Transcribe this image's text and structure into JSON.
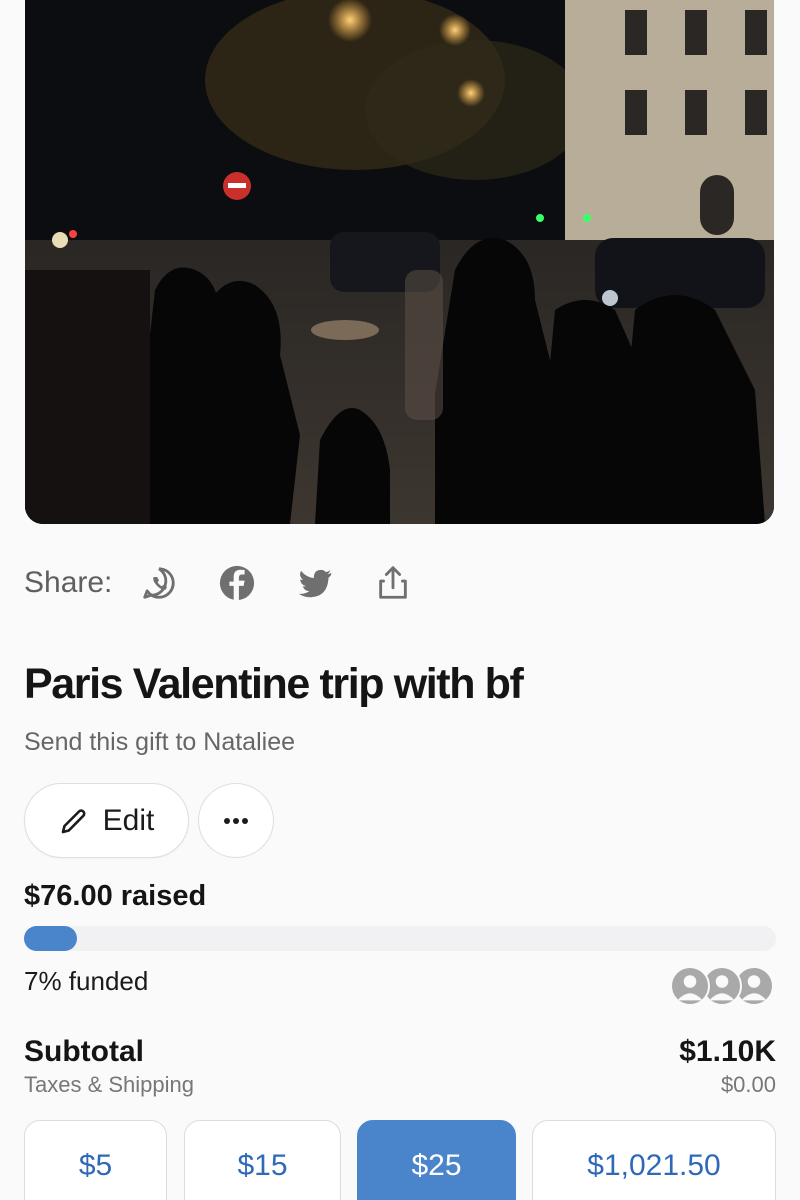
{
  "share": {
    "label": "Share:",
    "icons": [
      "whatsapp-icon",
      "facebook-icon",
      "twitter-icon",
      "share-icon"
    ]
  },
  "gift": {
    "title": "Paris Valentine trip with bf",
    "subtitle": "Send this gift to Nataliee"
  },
  "actions": {
    "edit_label": "Edit",
    "more_label": "•••"
  },
  "progress": {
    "raised_text": "$76.00 raised",
    "funded_text": "7% funded",
    "funded_fraction": 0.07
  },
  "summary": {
    "subtotal_label": "Subtotal",
    "subtotal_value": "$1.10K",
    "tax_label": "Taxes & Shipping",
    "tax_value": "$0.00"
  },
  "amounts": [
    {
      "label": "$5",
      "selected": false
    },
    {
      "label": "$15",
      "selected": false
    },
    {
      "label": "$25",
      "selected": true
    },
    {
      "label": "$1,021.50",
      "selected": false
    }
  ],
  "colors": {
    "accent": "#4a85cc",
    "accent_text": "#2f69b8",
    "muted_icon": "#6f6f6f"
  }
}
